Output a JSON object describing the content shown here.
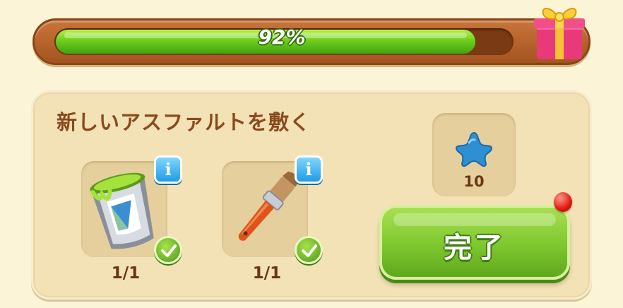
{
  "progress": {
    "percent_label": "92%",
    "fraction": 0.92
  },
  "task": {
    "title": "新しいアスファルトを敷く",
    "items": [
      {
        "icon": "paint-bucket-icon",
        "count": "1/1",
        "info_label": "i",
        "completed": true
      },
      {
        "icon": "paintbrush-icon",
        "count": "1/1",
        "info_label": "i",
        "completed": true
      }
    ]
  },
  "reward": {
    "icon": "blue-star-icon",
    "count": "10"
  },
  "complete_button": {
    "label": "完了"
  },
  "colors": {
    "progress_green": "#6fce1c",
    "frame_brown": "#a45420",
    "panel": "#f2e2b6",
    "title_brown": "#8b4a1e",
    "button_green": "#7fc72e",
    "info_blue": "#1e9ce6",
    "notification_red": "#e2170e",
    "star_blue": "#2e8fd2"
  }
}
